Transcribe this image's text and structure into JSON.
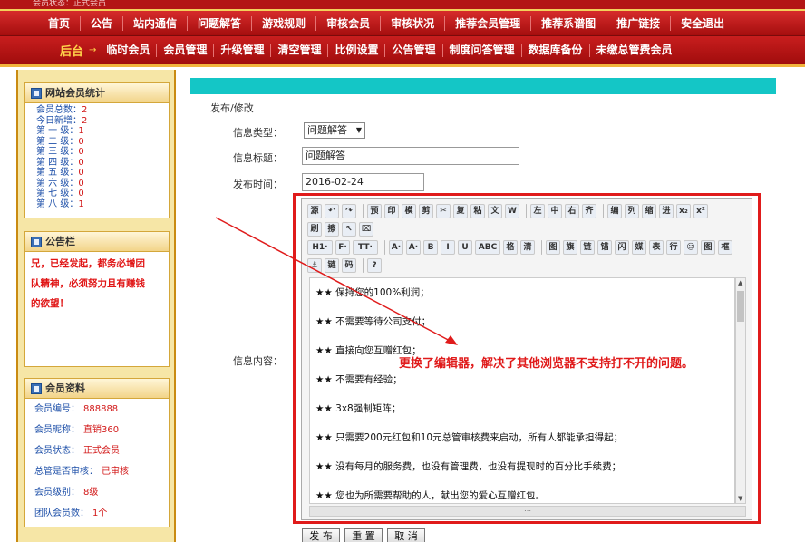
{
  "top_strip_text": "会员状态：正式会员",
  "nav_main": [
    "首页",
    "公告",
    "站内通信",
    "问题解答",
    "游戏规则",
    "审核会员",
    "审核状况",
    "推荐会员管理",
    "推荐系谱图",
    "推广链接",
    "安全退出"
  ],
  "nav_sub": {
    "home": "后台",
    "arrow": "→",
    "items": [
      "临时会员",
      "会员管理",
      "升级管理",
      "清空管理",
      "比例设置",
      "公告管理",
      "制度问答管理",
      "数据库备份",
      "未缴总管费会员"
    ]
  },
  "sidebar": {
    "stats_title": "网站会员统计",
    "stats": [
      {
        "label": "会员总数：",
        "value": "2"
      },
      {
        "label": "今日新增：",
        "value": "2"
      },
      {
        "label": "第 一 级：",
        "value": "1"
      },
      {
        "label": "第 二 级：",
        "value": "0"
      },
      {
        "label": "第 三 级：",
        "value": "0"
      },
      {
        "label": "第 四 级：",
        "value": "0"
      },
      {
        "label": "第 五 级：",
        "value": "0"
      },
      {
        "label": "第 六 级：",
        "value": "0"
      },
      {
        "label": "第 七 级：",
        "value": "0"
      },
      {
        "label": "第 八 级：",
        "value": "1"
      }
    ],
    "notice_title": "公告栏",
    "notice_lines": [
      "兄，已经发起，都务必增团",
      "队精神，必须努力且有赚钱",
      "的欲望！"
    ],
    "info_title": "会员资料",
    "info": [
      {
        "label": "会员编号：",
        "value": "888888"
      },
      {
        "label": "会员昵称：",
        "value": "直销360"
      },
      {
        "label": "会员状态：",
        "value": "正式会员"
      },
      {
        "label": "总管是否审核：",
        "value": "已审核"
      },
      {
        "label": "会员级别：",
        "value": "8级"
      },
      {
        "label": "团队会员数：",
        "value": "1个"
      }
    ]
  },
  "form": {
    "breadcrumb": "发布/修改",
    "type_label": "信息类型：",
    "type_value": "问题解答",
    "title_label": "信息标题：",
    "title_value": "问题解答",
    "time_label": "发布时间：",
    "time_value": "2016-02-24",
    "content_label": "信息内容："
  },
  "editor": {
    "row1": [
      "源",
      "↶",
      "↷",
      "|",
      "预",
      "印",
      "模",
      "剪",
      "✂",
      "复",
      "粘",
      "文",
      "W",
      "|",
      "左",
      "中",
      "右",
      "齐",
      "|",
      "编",
      "列",
      "缩",
      "进",
      "x₂",
      "x²"
    ],
    "row2": [
      "刷",
      "擦",
      "↖",
      "⌧"
    ],
    "row3": [
      "H1·",
      "F·",
      "TT·",
      "|",
      "A·",
      "A·",
      "B",
      "I",
      "U",
      "ABC",
      "格",
      "清",
      "|",
      "图",
      "旗",
      "链",
      "锚",
      "闪",
      "媒",
      "表",
      "行",
      "☺",
      "图",
      "框"
    ],
    "row4": [
      "⚓",
      "链",
      "码",
      "|",
      "?"
    ],
    "lines": [
      "★★ 保持您的100%利润；",
      "★★ 不需要等待公司支付；",
      "★★ 直接向您互赠红包；",
      "★★ 不需要有经验；",
      "★★ 3x8强制矩阵；",
      "★★ 只需要200元红包和10元总管审核费来启动，所有人都能承担得起；",
      "★★ 没有每月的服务费，也没有管理费，也没有提现时的百分比手续费；",
      "★★ 您也为所需要帮助的人，献出您的爱心互赠红包。"
    ]
  },
  "annotation": "更换了编辑器，解决了其他浏览器不支持打不开的问题。",
  "buttons": {
    "submit": "发 布",
    "reset": "重 置",
    "cancel": "取 消"
  },
  "colors": {
    "nav_red": "#b31515",
    "accent_yellow": "#ffd24a",
    "cyan_bar": "#14c6c6",
    "annot_red": "#e01b1b",
    "sidebar_bg": "#f6e6a6"
  }
}
